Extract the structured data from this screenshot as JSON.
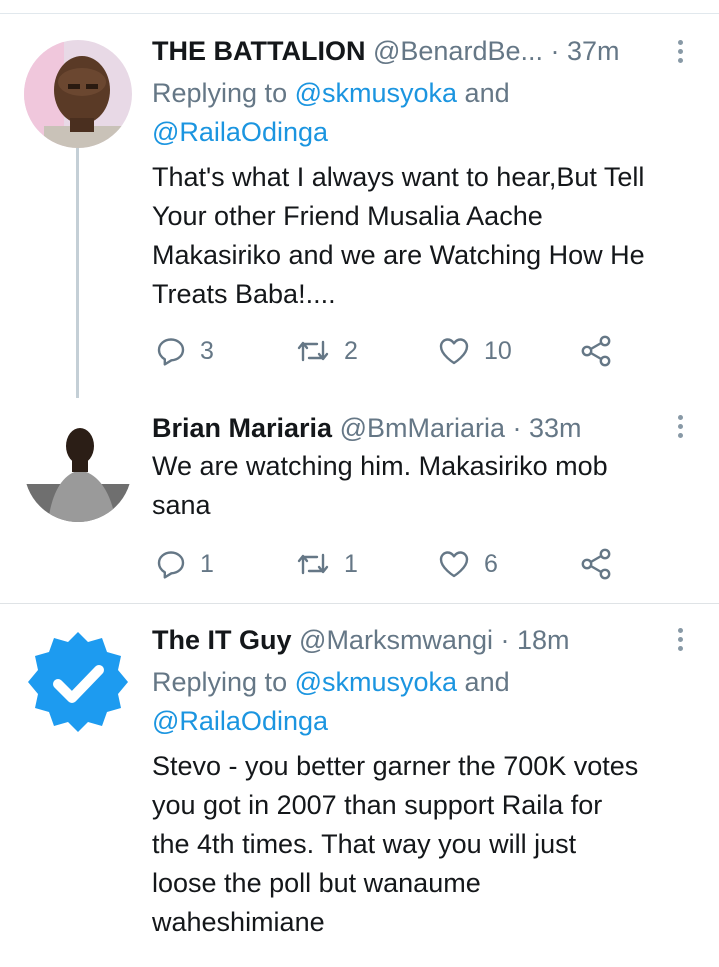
{
  "tweets": [
    {
      "name": "THE BATTALION",
      "meta": "@BenardBe... · 37m",
      "replying_prefix": "Replying to ",
      "mention1": "@skmusyoka",
      "and": " and",
      "mention2": "@RailaOdinga",
      "lines": [
        "That's what I always want to hear,But Tell",
        "Your other Friend Musalia Aache",
        "Makasiriko and we are Watching How He",
        "Treats Baba!...."
      ],
      "replies": "3",
      "retweets": "2",
      "likes": "10"
    },
    {
      "name": "Brian Mariaria",
      "meta": "@BmMariaria · 33m",
      "lines": [
        "We are watching him. Makasiriko mob",
        "sana"
      ],
      "replies": "1",
      "retweets": "1",
      "likes": "6"
    },
    {
      "name": "The IT Guy",
      "meta": "@Marksmwangi · 18m",
      "replying_prefix": "Replying to ",
      "mention1": "@skmusyoka",
      "and": " and",
      "mention2": "@RailaOdinga",
      "lines": [
        "Stevo - you better garner the 700K votes",
        "you got in 2007 than support Raila for",
        "the 4th times. That way you will just",
        "loose the poll but wanaume",
        "waheshimiane"
      ]
    }
  ],
  "icons": {
    "reply": "reply-icon",
    "retweet": "retweet-icon",
    "like": "heart-icon",
    "share": "share-icon",
    "more": "more-vertical-icon",
    "verified": "verified-badge-icon"
  },
  "colors": {
    "link": "#1b95e0",
    "secondary": "#657786",
    "verified": "#1d9bf0",
    "thread": "#c4cfd6"
  }
}
